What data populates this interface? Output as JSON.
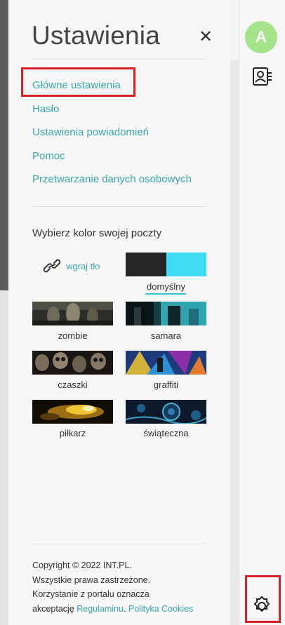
{
  "header": {
    "title": "Ustawienia",
    "close_icon": "close-icon"
  },
  "menu": {
    "items": [
      {
        "label": "Główne ustawienia",
        "highlighted": true
      },
      {
        "label": "Hasło"
      },
      {
        "label": "Ustawienia powiadomień"
      },
      {
        "label": "Pomoc"
      },
      {
        "label": "Przetwarzanie danych osobowych"
      }
    ]
  },
  "themes": {
    "heading": "Wybierz kolor swojej poczty",
    "upload_label": "wgraj tło",
    "upload_icon": "paperclip-icon",
    "default": {
      "label": "domyślny",
      "colors": [
        "#252525",
        "#3ddcf2"
      ],
      "selected": true
    },
    "items": [
      {
        "label": "zombie"
      },
      {
        "label": "samara"
      },
      {
        "label": "czaszki"
      },
      {
        "label": "graffiti"
      },
      {
        "label": "piłkarz"
      },
      {
        "label": "świąteczna"
      }
    ]
  },
  "footer": {
    "line1": "Copyright © 2022 INT.PL.",
    "line2": "Wszystkie prawa zastrzeżone.",
    "line3": "Korzystanie z portalu oznacza",
    "line4_prefix": "akceptację ",
    "terms_link": "Regulaminu",
    "separator": ". ",
    "cookies_link": "Polityka Cookies"
  },
  "rail": {
    "avatar_letter": "A",
    "avatar_color": "#a6e48c",
    "contacts_icon": "contacts-icon",
    "settings_icon": "gear-icon"
  },
  "colors": {
    "accent": "#39a8ad",
    "highlight": "#d6202a"
  }
}
